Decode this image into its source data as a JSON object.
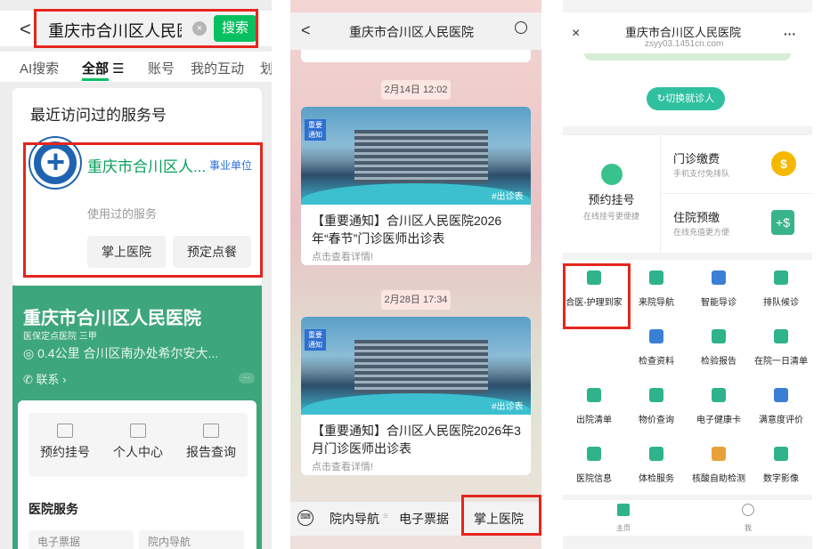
{
  "panel1": {
    "search": {
      "back": "<",
      "query": "重庆市合川区人民医",
      "clear": "×",
      "button": "搜索"
    },
    "tabs": [
      "AI搜索",
      "全部 ☰",
      "账号",
      "我的互动",
      "划"
    ],
    "recent": {
      "title": "最近访问过的服务号",
      "name": "重庆市合川区人...",
      "tag": "事业单位",
      "used_label": "使用过的服务",
      "chips": [
        "掌上医院",
        "预定点餐"
      ]
    },
    "hospital": {
      "name": "重庆市合川区人民医院",
      "level": "医保定点医院 三甲",
      "address": "◎ 0.4公里 合川区南办处希尔安大...",
      "contact": "✆ 联系 ›",
      "more": "···"
    },
    "actions": [
      "预约挂号",
      "个人中心",
      "报告查询"
    ],
    "services_title": "医院服务",
    "stubs": [
      "电子票据",
      "院内导航"
    ]
  },
  "panel2": {
    "title": "重庆市合川区人民医院",
    "back": "<",
    "messages": [
      {
        "time": "2月14日 12:02",
        "badge": "重要 通知",
        "hashtag": "#出诊表",
        "text": "【重要通知】合川区人民医院2026年“春节”门诊医师出诊表",
        "sub": "点击查看详情!"
      },
      {
        "time": "2月28日 17:34",
        "badge": "重要 通知",
        "hashtag": "#出诊表",
        "text": "【重要通知】合川区人民医院2026年3月门诊医师出诊表",
        "sub": "点击查看详情!"
      }
    ],
    "menu": [
      "院内导航",
      "电子票据",
      "掌上医院"
    ],
    "keyboard_icon": "⌨"
  },
  "panel3": {
    "title": "重庆市合川区人民医院",
    "url": "zsyy03.1451cn.com",
    "close": "×",
    "more": "···",
    "switch_btn": "↻切换就诊人",
    "register": {
      "label": "预约挂号",
      "sub": "在线挂号更便捷"
    },
    "outpatient": {
      "label": "门诊缴费",
      "sub": "手机支付免排队",
      "glyph": "$"
    },
    "inpatient": {
      "label": "住院预缴",
      "sub": "在线充值更方便",
      "glyph": "+$"
    },
    "grid": [
      {
        "label": "合医-护理到家",
        "color": "#2fb38a"
      },
      {
        "label": "来院导航",
        "color": "#2fb38a"
      },
      {
        "label": "智能导诊",
        "color": "#3a7fd5"
      },
      {
        "label": "排队候诊",
        "color": "#2fb38a"
      },
      {
        "label": "检查资料",
        "color": "#3a7fd5"
      },
      {
        "label": "检验报告",
        "color": "#2fb38a"
      },
      {
        "label": "在院一日清单",
        "color": "#2fb38a"
      },
      {
        "label": "出院清单",
        "color": "#2fb38a"
      },
      {
        "label": "物价查询",
        "color": "#2fb38a"
      },
      {
        "label": "电子健康卡",
        "color": "#2fb38a"
      },
      {
        "label": "满意度评价",
        "color": "#3a7fd5"
      },
      {
        "label": "医院信息",
        "color": "#2fb38a"
      },
      {
        "label": "体检服务",
        "color": "#2fb38a"
      },
      {
        "label": "核酸自助检测",
        "color": "#e8a13a"
      },
      {
        "label": "数字影像",
        "color": "#2fb38a"
      }
    ],
    "tabbar": [
      "主页",
      "我"
    ]
  },
  "colors": {
    "wechat_green": "#07c160",
    "hospital_green": "#3ea67c",
    "highlight_red": "#e5251d"
  }
}
